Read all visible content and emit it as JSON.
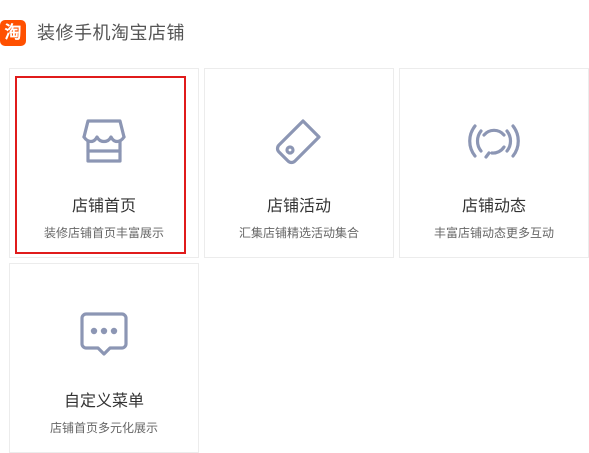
{
  "header": {
    "logo_text": "淘",
    "title": "装修手机淘宝店铺"
  },
  "colors": {
    "brand": "#ff5000",
    "icon": "#8c96b4",
    "selection": "#e01b1b",
    "border": "#ececec"
  },
  "cards": [
    {
      "name": "店铺首页",
      "desc": "装修店铺首页丰富展示",
      "icon": "storefront-icon",
      "selected": true
    },
    {
      "name": "店铺活动",
      "desc": "汇集店铺精选活动集合",
      "icon": "tag-icon",
      "selected": false
    },
    {
      "name": "店铺动态",
      "desc": "丰富店铺动态更多互动",
      "icon": "broadcast-icon",
      "selected": false
    },
    {
      "name": "自定义菜单",
      "desc": "店铺首页多元化展示",
      "icon": "message-menu-icon",
      "selected": false
    }
  ]
}
